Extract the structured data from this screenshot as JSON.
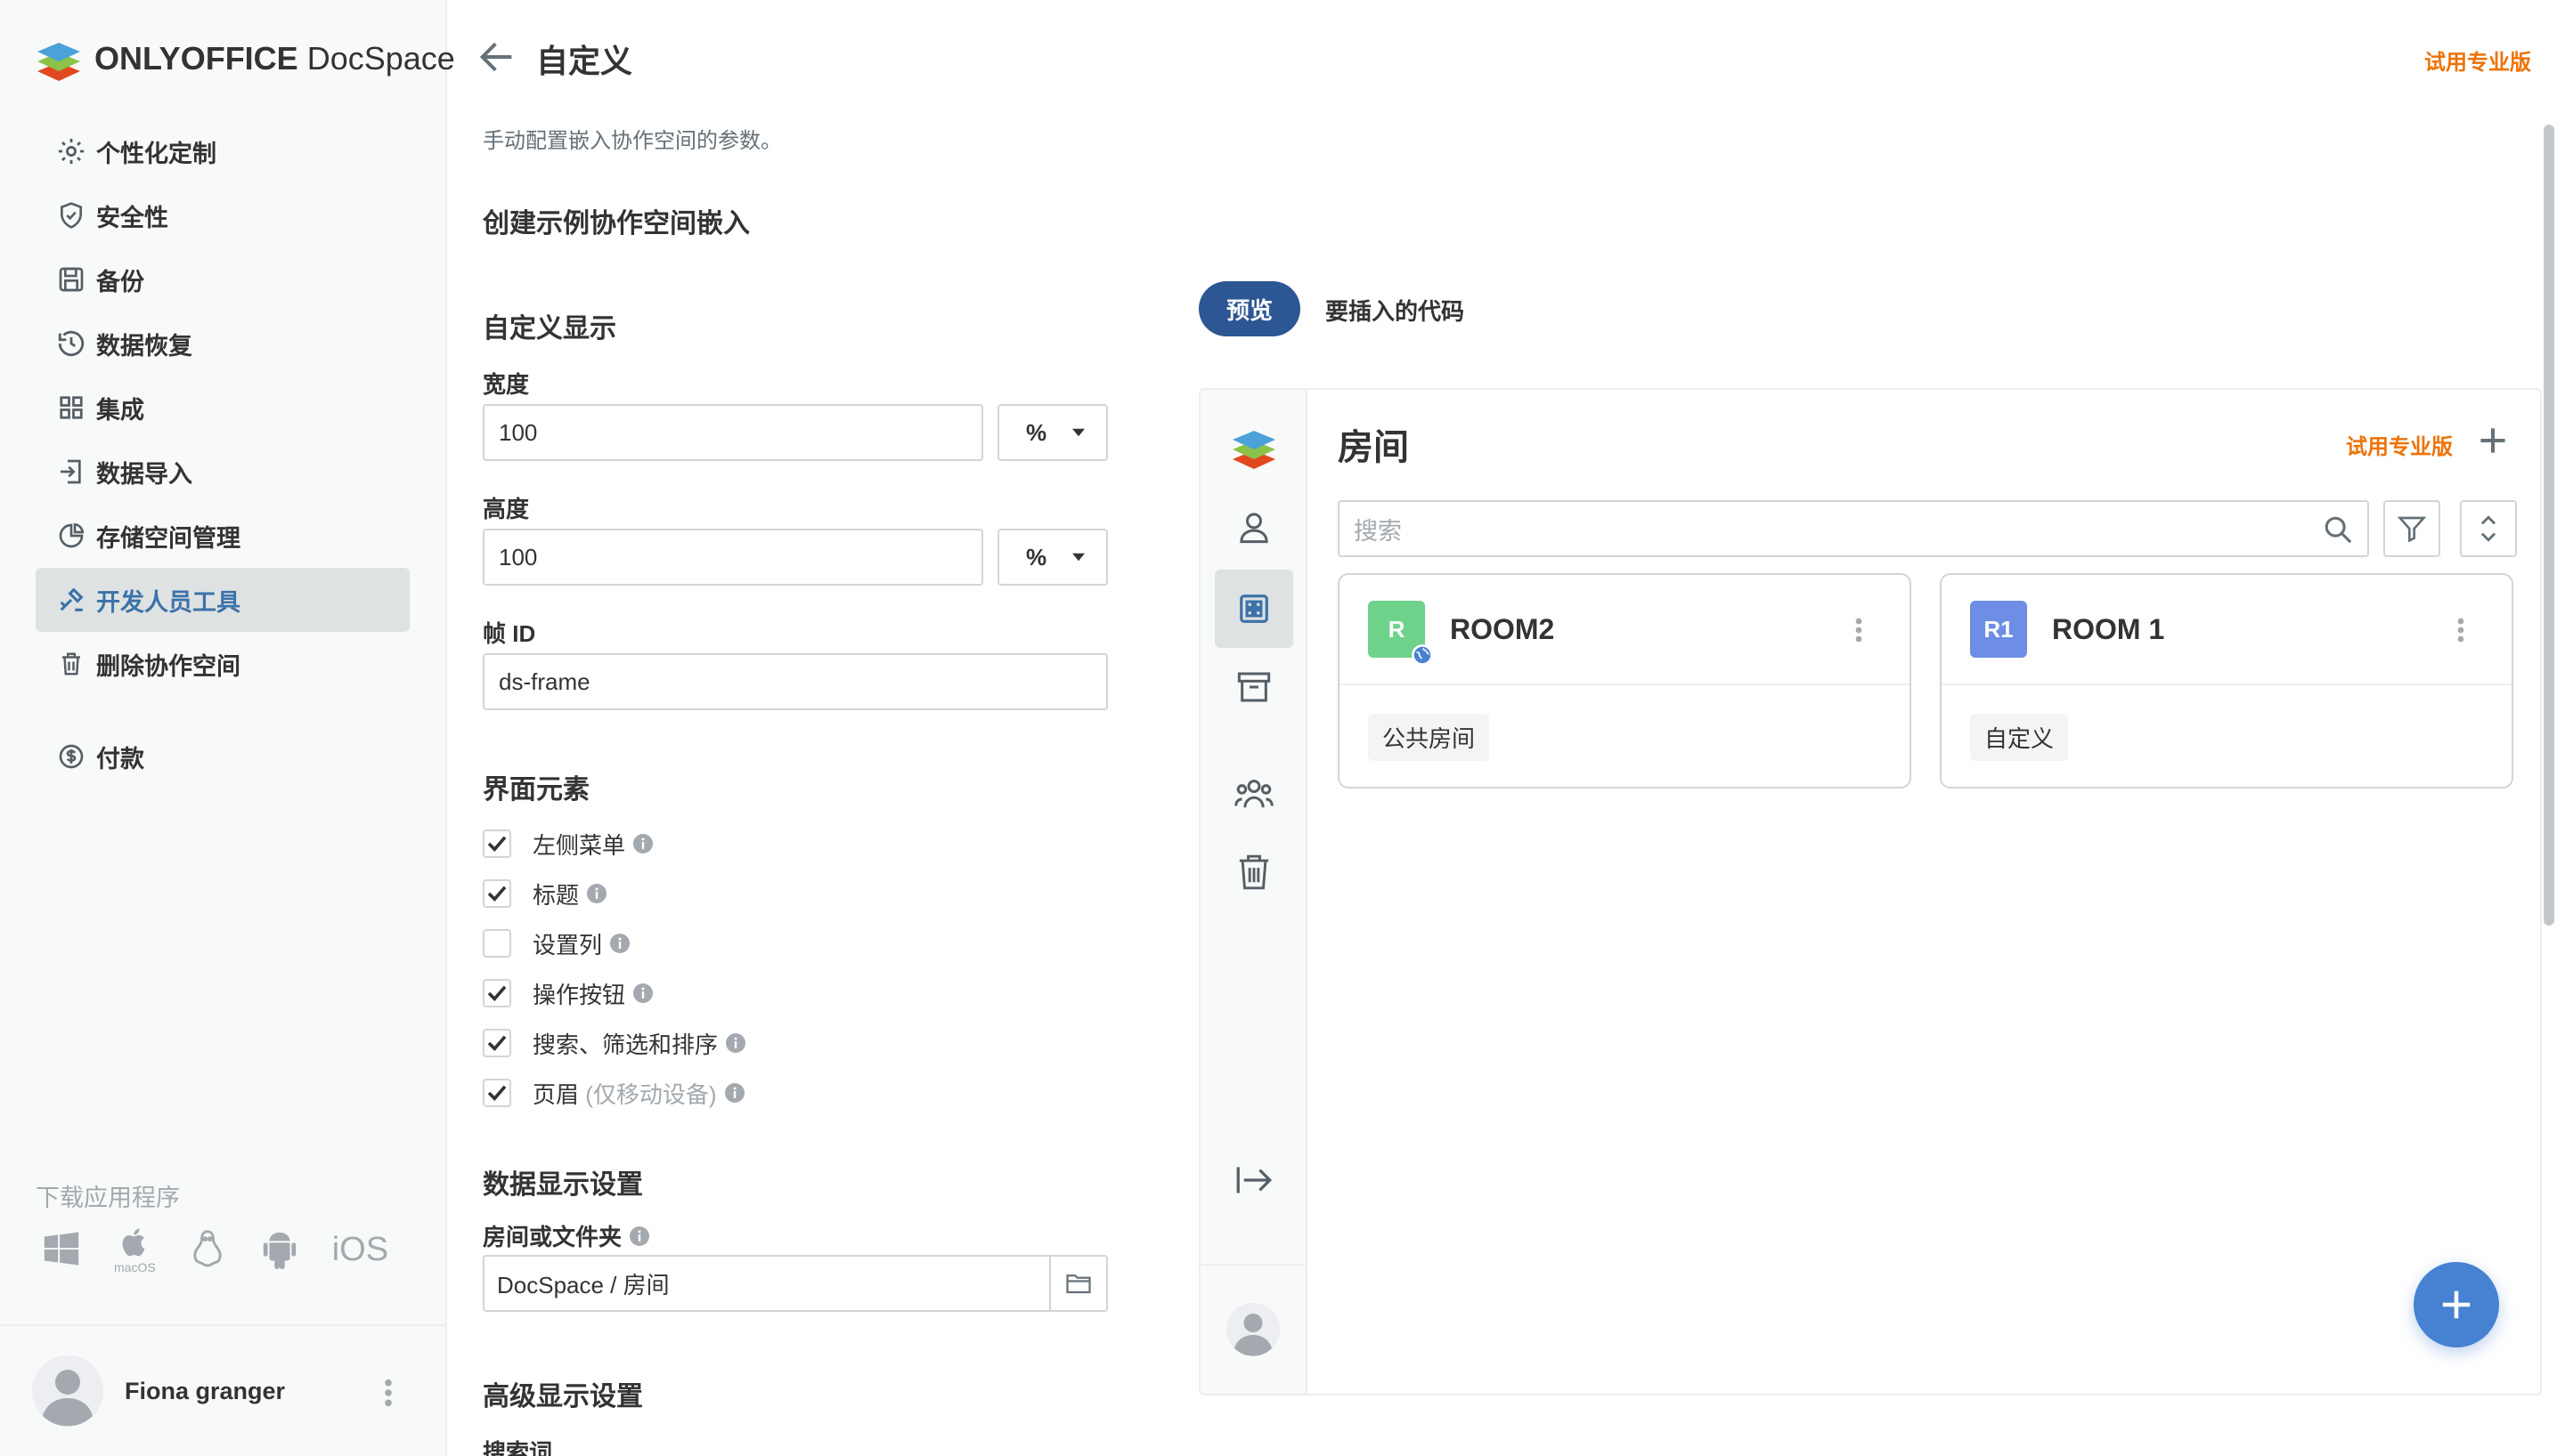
{
  "sidebar": {
    "logo": {
      "brand": "ONLYOFFICE",
      "product": "DocSpace"
    },
    "items": [
      {
        "label": "个性化定制",
        "icon": "gear-icon"
      },
      {
        "label": "安全性",
        "icon": "shield-icon"
      },
      {
        "label": "备份",
        "icon": "save-icon"
      },
      {
        "label": "数据恢复",
        "icon": "history-icon"
      },
      {
        "label": "集成",
        "icon": "grid-icon"
      },
      {
        "label": "数据导入",
        "icon": "import-icon"
      },
      {
        "label": "存储空间管理",
        "icon": "pie-icon"
      },
      {
        "label": "开发人员工具",
        "icon": "developer-tools-icon",
        "active": true
      },
      {
        "label": "删除协作空间",
        "icon": "trash-icon"
      },
      {
        "label": "付款",
        "icon": "dollar-icon"
      }
    ],
    "download_label": "下载应用程序",
    "apps": {
      "macos": "macOS",
      "ios": "iOS"
    },
    "profile": {
      "name": "Fiona granger"
    }
  },
  "header": {
    "title": "自定义",
    "try_pro": "试用专业版"
  },
  "main": {
    "description": "手动配置嵌入协作空间的参数。",
    "section_title": "创建示例协作空间嵌入",
    "display": {
      "title": "自定义显示",
      "width_label": "宽度",
      "width_value": "100",
      "width_unit": "%",
      "height_label": "高度",
      "height_value": "100",
      "height_unit": "%",
      "frame_id_label": "帧 ID",
      "frame_id_value": "ds-frame"
    },
    "interface": {
      "title": "界面元素",
      "items": [
        {
          "label": "左侧菜单",
          "checked": true
        },
        {
          "label": "标题",
          "checked": true
        },
        {
          "label": "设置列",
          "checked": false
        },
        {
          "label": "操作按钮",
          "checked": true
        },
        {
          "label": "搜索、筛选和排序",
          "checked": true
        },
        {
          "label": "页眉",
          "suffix": "(仅移动设备)",
          "checked": true
        }
      ]
    },
    "data_display": {
      "title": "数据显示设置",
      "folder_label": "房间或文件夹",
      "folder_value": "DocSpace / 房间"
    },
    "advanced": {
      "title": "高级显示设置",
      "search_label": "搜索词"
    }
  },
  "preview": {
    "tab_preview": "预览",
    "tab_code": "要插入的代码",
    "rooms_title": "房间",
    "try_pro": "试用专业版",
    "search_placeholder": "搜索",
    "rooms": [
      {
        "logo": "R",
        "name": "ROOM2",
        "tag": "公共房间",
        "color": "#6fd28b"
      },
      {
        "logo": "R1",
        "name": "ROOM 1",
        "tag": "自定义",
        "color": "#6d8ee4"
      }
    ]
  },
  "colors": {
    "accent": "#2c5694",
    "brand_orange": "#ed7309",
    "fab": "#4781d1",
    "active_nav": "#3b72a7"
  }
}
